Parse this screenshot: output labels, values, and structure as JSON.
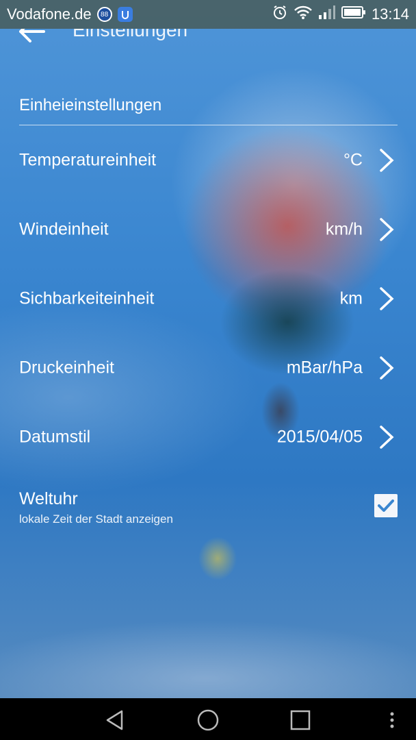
{
  "status_bar": {
    "carrier": "Vodafone.de",
    "badge_text": "88",
    "time": "13:14",
    "icons": [
      "alarm-icon",
      "wifi-icon",
      "signal-icon",
      "battery-icon"
    ]
  },
  "toolbar": {
    "title": "Einstellungen",
    "back_icon": "arrow-left-icon"
  },
  "section": {
    "header": "Einheieinstellungen"
  },
  "settings": [
    {
      "label": "Temperatureinheit",
      "value": "°C"
    },
    {
      "label": "Windeinheit",
      "value": "km/h"
    },
    {
      "label": "Sichbarkeiteinheit",
      "value": "km"
    },
    {
      "label": "Druckeinheit",
      "value": "mBar/hPa"
    },
    {
      "label": "Datumstil",
      "value": "2015/04/05"
    }
  ],
  "world_clock": {
    "label": "Weltuhr",
    "sublabel": "lokale Zeit der Stadt anzeigen",
    "checked": true
  },
  "nav_bar": {
    "icons": [
      "back-triangle-icon",
      "home-circle-icon",
      "recents-square-icon",
      "more-dots-icon"
    ]
  },
  "colors": {
    "checkbox_check": "#3a86d0",
    "nav_background": "#000000"
  }
}
